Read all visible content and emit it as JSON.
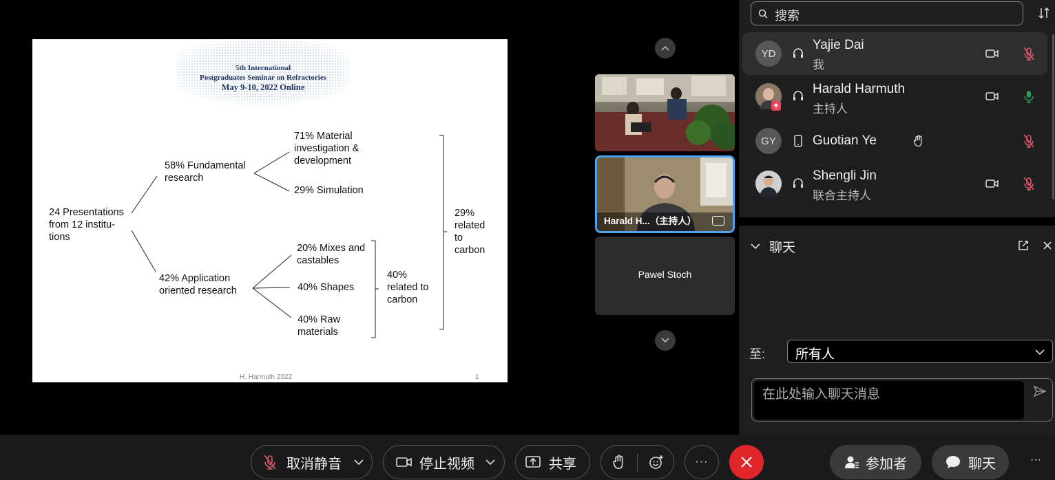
{
  "slide": {
    "title_line1": "5th International",
    "title_line2": "Postgraduates Seminar on Refractories",
    "title_line3": "May 9-10, 2022 Online",
    "root": "24 Presentations\nfrom 12 institu-\ntions",
    "fundamental": "58% Fundamental\nresearch",
    "material": "71% Material\ninvestigation &\ndevelopment",
    "simulation": "29% Simulation",
    "application": "42% Application\noriented research",
    "mixes": "20% Mixes and\ncastables",
    "shapes": "40% Shapes",
    "raw": "40% Raw\nmaterials",
    "carbon40": "40%\nrelated to\ncarbon",
    "carbon29": "29%\nrelated\nto\ncarbon",
    "footer_author": "H. Harmuth 2022",
    "footer_page": "1"
  },
  "videos": {
    "tile2_name": "Harald H...（主持人）",
    "tile3_name": "Pawel Stoch"
  },
  "participants": {
    "search_placeholder": "搜索",
    "list": [
      {
        "avatar": "YD",
        "name": "Yajie Dai",
        "role": "我"
      },
      {
        "avatar": "",
        "name": "Harald Harmuth",
        "role": "主持人"
      },
      {
        "avatar": "GY",
        "name": "Guotian Ye",
        "role": ""
      },
      {
        "avatar": "",
        "name": "Shengli Jin",
        "role": "联合主持人"
      }
    ]
  },
  "chat": {
    "title": "聊天",
    "to_label": "至:",
    "to_value": "所有人",
    "input_placeholder": "在此处输入聊天消息"
  },
  "toolbar": {
    "mute_label": "取消静音",
    "video_label": "停止视频",
    "share_label": "共享",
    "participants_label": "参加者",
    "chat_label": "聊天",
    "more_label": "···"
  },
  "colors": {
    "end_call": "#e0262b",
    "muted_icon": "#e05a6a",
    "unmuted_icon": "#2e9e5b",
    "active_tile_border": "#4aa3f0"
  }
}
